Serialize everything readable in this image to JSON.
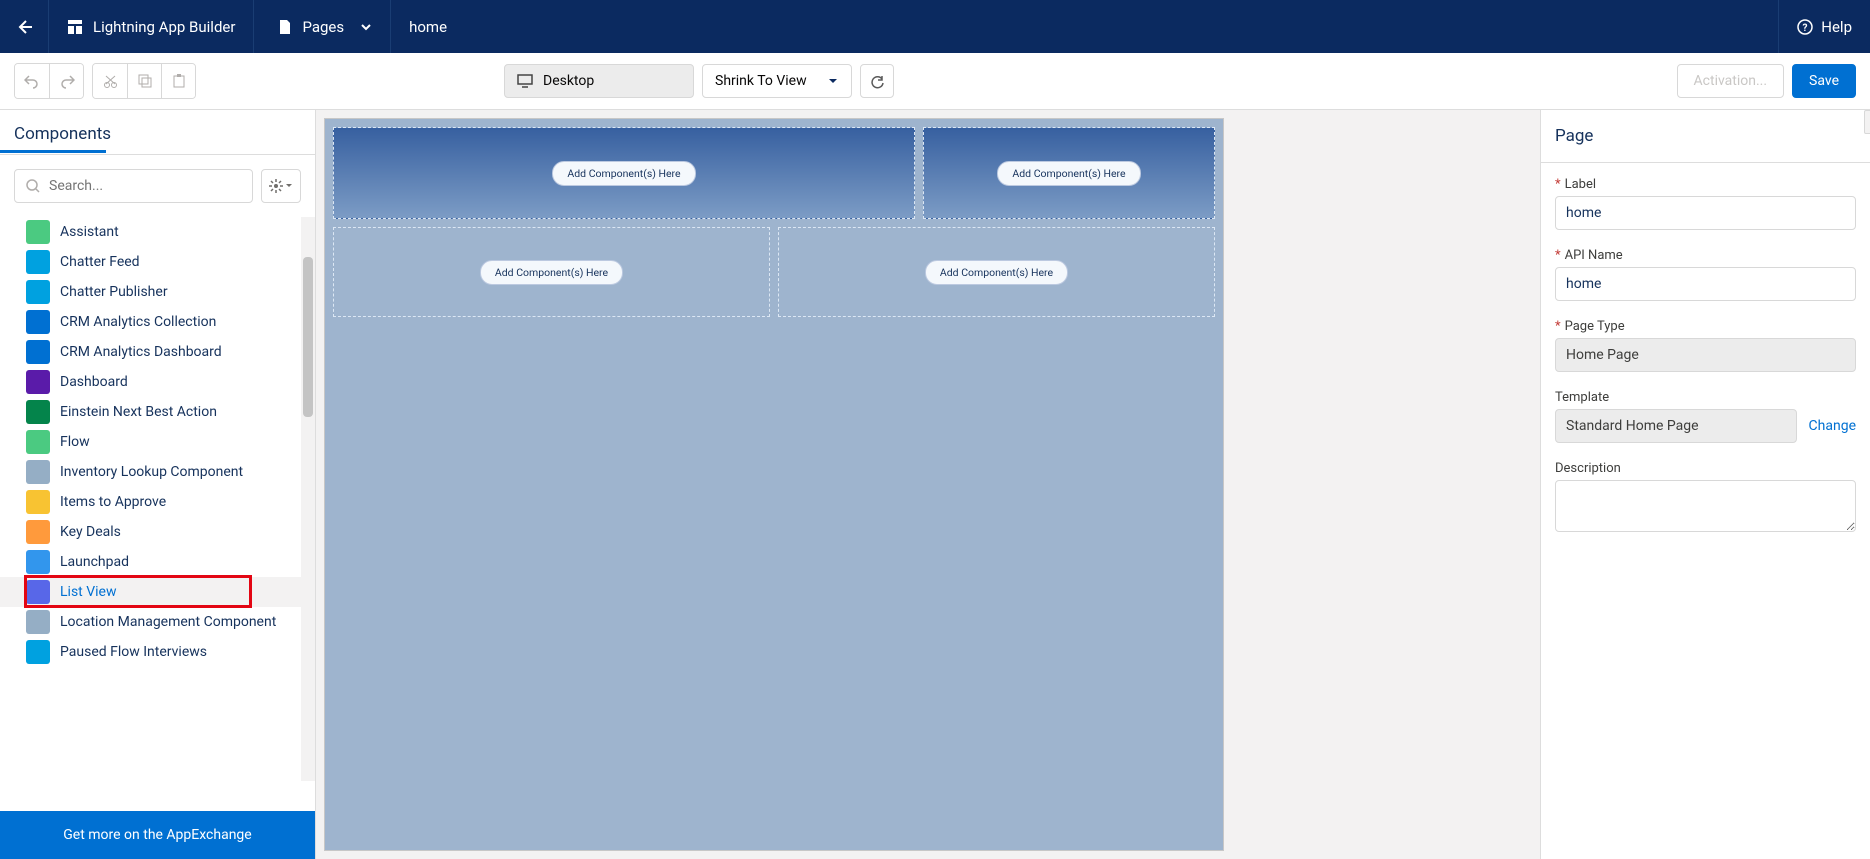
{
  "header": {
    "app_title": "Lightning App Builder",
    "pages_label": "Pages",
    "page_name": "home",
    "help_label": "Help"
  },
  "toolbar": {
    "device_label": "Desktop",
    "shrink_label": "Shrink To View",
    "activation_label": "Activation...",
    "save_label": "Save"
  },
  "left_panel": {
    "title": "Components",
    "search_placeholder": "Search...",
    "items": [
      {
        "label": "Assistant",
        "icon_color": "c-green"
      },
      {
        "label": "Chatter Feed",
        "icon_color": "c-teal"
      },
      {
        "label": "Chatter Publisher",
        "icon_color": "c-teal"
      },
      {
        "label": "CRM Analytics Collection",
        "icon_color": "c-blue2"
      },
      {
        "label": "CRM Analytics Dashboard",
        "icon_color": "c-blue2"
      },
      {
        "label": "Dashboard",
        "icon_color": "c-violet"
      },
      {
        "label": "Einstein Next Best Action",
        "icon_color": "c-green2"
      },
      {
        "label": "Flow",
        "icon_color": "c-green"
      },
      {
        "label": "Inventory Lookup Component",
        "icon_color": "c-gray"
      },
      {
        "label": "Items to Approve",
        "icon_color": "c-yellow"
      },
      {
        "label": "Key Deals",
        "icon_color": "c-bar"
      },
      {
        "label": "Launchpad",
        "icon_color": "c-grid"
      },
      {
        "label": "List View",
        "icon_color": "c-lv"
      },
      {
        "label": "Location Management Component",
        "icon_color": "c-gray"
      },
      {
        "label": "Paused Flow Interviews",
        "icon_color": "c-teal"
      }
    ],
    "appexchange_label": "Get more on the AppExchange"
  },
  "canvas": {
    "pill_label": "Add Component(s) Here"
  },
  "right_panel": {
    "title": "Page",
    "label_label": "Label",
    "label_value": "home",
    "api_label": "API Name",
    "api_value": "home",
    "pagetype_label": "Page Type",
    "pagetype_value": "Home Page",
    "template_label": "Template",
    "template_value": "Standard Home Page",
    "change_label": "Change",
    "description_label": "Description"
  },
  "highlight": {
    "label": "List View"
  }
}
